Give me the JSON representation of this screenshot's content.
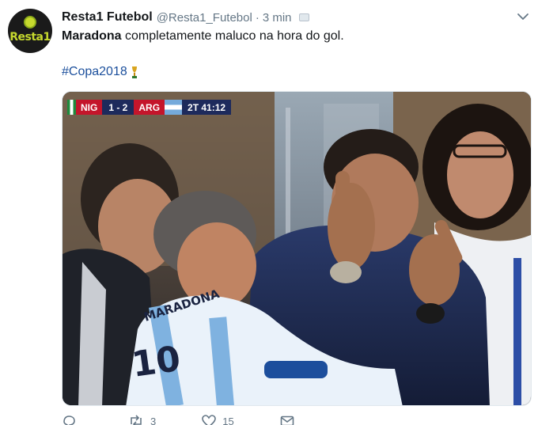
{
  "tweet": {
    "author": {
      "display_name": "Resta1 Futebol",
      "handle": "@Resta1_Futebol",
      "avatar_text": "Resta1",
      "avatar_icon": "soccer-ball-icon"
    },
    "separator": "·",
    "time": "3 min",
    "text_bold": "Maradona",
    "text_rest": " completamente maluco na hora do gol.",
    "hashtag": "#Copa2018",
    "hashtag_emoji": "trophy-icon",
    "colors": {
      "link": "#1b4f9c",
      "muted": "#657786",
      "brand": "#c6d92e"
    }
  },
  "media": {
    "scorebug": {
      "team_home": "NIG",
      "score": "1 - 2",
      "team_away": "ARG",
      "clock": "2T 41:12"
    },
    "shirt_text": "MARADONA",
    "shirt_number": "10"
  },
  "actions": {
    "reply_count": "",
    "retweet_count": "3",
    "like_count": "15"
  }
}
